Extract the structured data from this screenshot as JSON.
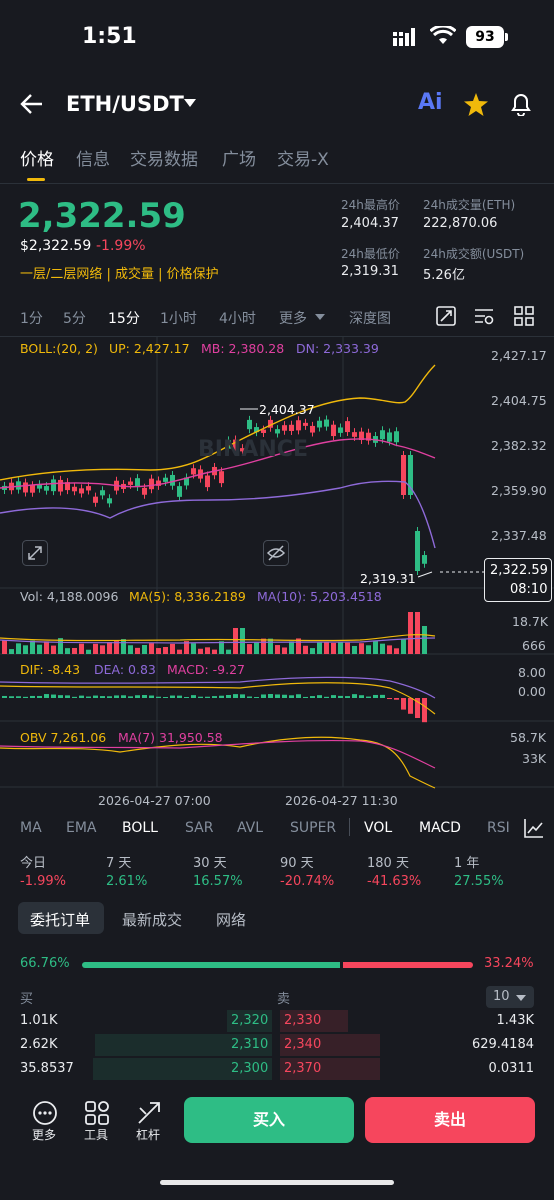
{
  "status_bar": {
    "time": "1:51",
    "battery": "93"
  },
  "header": {
    "pair": "ETH/USDT",
    "ai_label": "Ai"
  },
  "tabs": [
    "价格",
    "信息",
    "交易数据",
    "广场",
    "交易-X"
  ],
  "price": {
    "last": "2,322.59",
    "usd": "$2,322.59",
    "change_pct": "-1.99%",
    "tags": "一层/二层网络 | 成交量 | 价格保护",
    "stats": {
      "high_label": "24h最高价",
      "high": "2,404.37",
      "vol_eth_label": "24h成交量(ETH)",
      "vol_eth": "222,870.06",
      "low_label": "24h最低价",
      "low": "2,319.31",
      "vol_usdt_label": "24h成交额(USDT)",
      "vol_usdt": "5.26亿"
    }
  },
  "intervals": [
    "1分",
    "5分",
    "15分",
    "1小时",
    "4小时",
    "更多",
    "深度图"
  ],
  "chart": {
    "boll_label": "BOLL:(20, 2)",
    "up": "UP: 2,427.17",
    "mb": "MB: 2,380.28",
    "dn": "DN: 2,333.39",
    "price_ticks": [
      "2,427.17",
      "2,404.75",
      "2,382.32",
      "2,359.90",
      "2,337.48"
    ],
    "high_marker": "2,404.37",
    "low_marker": "2,319.31",
    "current_price": "2,322.59",
    "countdown": "08:10",
    "watermark": "BINANCE",
    "vol": "Vol: 4,188.0096",
    "vol_ma5": "MA(5): 8,336.2189",
    "vol_ma10": "MA(10): 5,203.4518",
    "vol_ticks": [
      "18.7K",
      "666"
    ],
    "dif": "DIF: -8.43",
    "dea": "DEA: 0.83",
    "macd": "MACD: -9.27",
    "macd_ticks": [
      "8.00",
      "0.00"
    ],
    "obv": "OBV 7,261.06",
    "obv_ma": "MA(7) 31,950.58",
    "obv_ticks": [
      "58.7K",
      "33K"
    ],
    "time_labels": [
      "2026-04-27 07:00",
      "2026-04-27 11:30"
    ]
  },
  "indicator_tabs": [
    "MA",
    "EMA",
    "BOLL",
    "SAR",
    "AVL",
    "SUPER",
    "VOL",
    "MACD",
    "RSI"
  ],
  "performance": [
    {
      "label": "今日",
      "value": "-1.99%",
      "dir": "down"
    },
    {
      "label": "7 天",
      "value": "2.61%",
      "dir": "up"
    },
    {
      "label": "30 天",
      "value": "16.57%",
      "dir": "up"
    },
    {
      "label": "90 天",
      "value": "-20.74%",
      "dir": "down"
    },
    {
      "label": "180 天",
      "value": "-41.63%",
      "dir": "down"
    },
    {
      "label": "1 年",
      "value": "27.55%",
      "dir": "up"
    }
  ],
  "order_tabs": [
    "委托订单",
    "最新成交",
    "网络"
  ],
  "ratio": {
    "buy": "66.76%",
    "sell": "33.24%",
    "buy_fraction": 0.6676
  },
  "orderbook": {
    "buy_label": "买",
    "sell_label": "卖",
    "depth": "10",
    "rows": [
      {
        "bid_qty": "1.01K",
        "bid_price": "2,320",
        "ask_price": "2,330",
        "ask_qty": "1.43K"
      },
      {
        "bid_qty": "2.62K",
        "bid_price": "2,310",
        "ask_price": "2,340",
        "ask_qty": "629.4184"
      },
      {
        "bid_qty": "35.8537",
        "bid_price": "2,300",
        "ask_price": "2,370",
        "ask_qty": "0.0311"
      }
    ]
  },
  "bottom_bar": {
    "more": "更多",
    "tools": "工具",
    "leverage": "杠杆",
    "buy": "买入",
    "sell": "卖出"
  }
}
